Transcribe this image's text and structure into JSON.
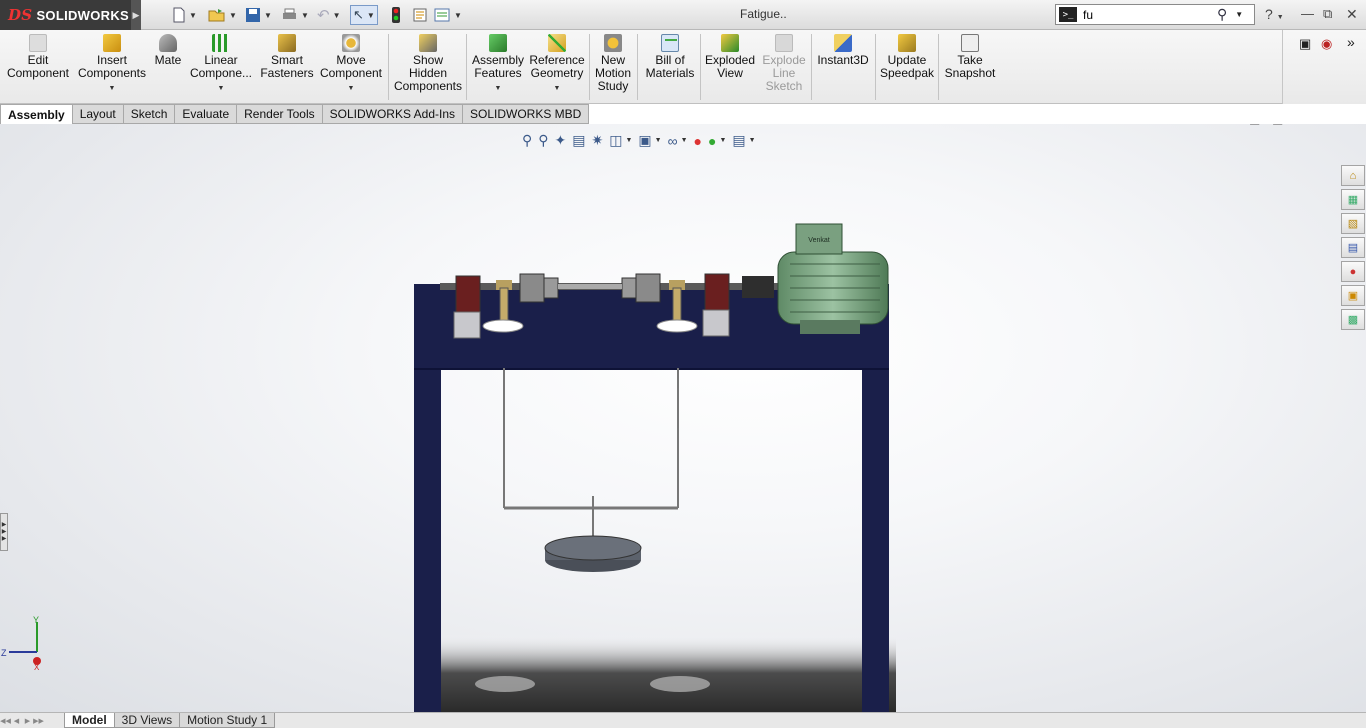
{
  "app": {
    "logo_prefix": "DS",
    "logo_text": "SOLIDWORKS"
  },
  "title_bar": {
    "doc_title": "Fatigue..",
    "search_value": "fu",
    "search_prefix": ">_",
    "help": "?"
  },
  "toolbar": [
    {
      "label": "Edit Component",
      "lines": [
        "Edit",
        "Component"
      ],
      "disabled": true
    },
    {
      "label": "Insert Components",
      "lines": [
        "Insert",
        "Components"
      ],
      "dropdown": true
    },
    {
      "label": "Mate",
      "lines": [
        "Mate"
      ]
    },
    {
      "label": "Linear Component Pattern",
      "lines": [
        "Linear",
        "Compone..."
      ],
      "dropdown": true
    },
    {
      "label": "Smart Fasteners",
      "lines": [
        "Smart",
        "Fasteners"
      ]
    },
    {
      "label": "Move Component",
      "lines": [
        "Move",
        "Component"
      ],
      "dropdown": true
    },
    {
      "label": "Show Hidden Components",
      "lines": [
        "Show",
        "Hidden",
        "Components"
      ]
    },
    {
      "label": "Assembly Features",
      "lines": [
        "Assembly",
        "Features"
      ],
      "dropdown": true
    },
    {
      "label": "Reference Geometry",
      "lines": [
        "Reference",
        "Geometry"
      ],
      "dropdown": true
    },
    {
      "label": "New Motion Study",
      "lines": [
        "New",
        "Motion",
        "Study"
      ]
    },
    {
      "label": "Bill of Materials",
      "lines": [
        "Bill of",
        "Materials"
      ]
    },
    {
      "label": "Exploded View",
      "lines": [
        "Exploded",
        "View"
      ]
    },
    {
      "label": "Explode Line Sketch",
      "lines": [
        "Explode",
        "Line",
        "Sketch"
      ],
      "disabled": true
    },
    {
      "label": "Instant3D",
      "lines": [
        "Instant3D"
      ]
    },
    {
      "label": "Update Speedpak",
      "lines": [
        "Update",
        "Speedpak"
      ]
    },
    {
      "label": "Take Snapshot",
      "lines": [
        "Take",
        "Snapshot"
      ]
    }
  ],
  "tabs": [
    "Assembly",
    "Layout",
    "Sketch",
    "Evaluate",
    "Render Tools",
    "SOLIDWORKS Add-Ins",
    "SOLIDWORKS MBD"
  ],
  "active_tab": "Assembly",
  "bottom_tabs": [
    "Model",
    "3D Views",
    "Motion Study 1"
  ],
  "active_bottom_tab": "Model",
  "triad": {
    "y": "Y",
    "z": "Z",
    "x": "X"
  },
  "motor_label": "Venkat"
}
